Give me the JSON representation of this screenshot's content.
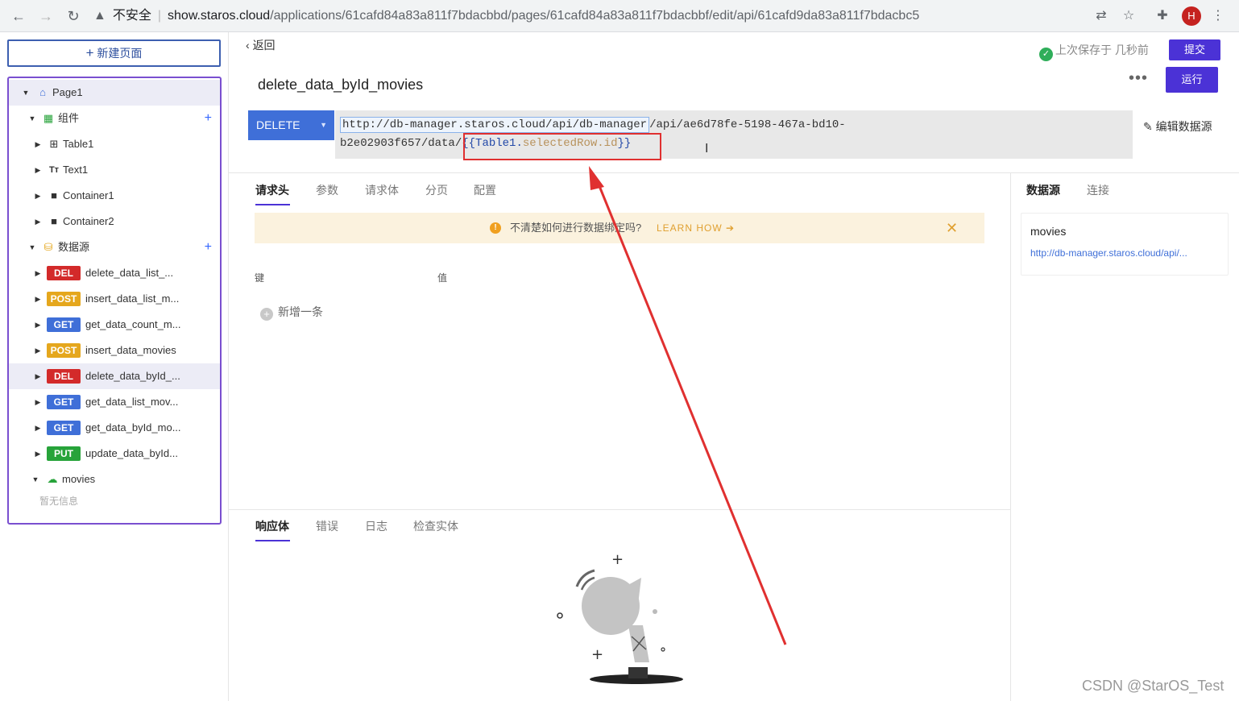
{
  "browser": {
    "insecure_label": "不安全",
    "domain": "show.staros.cloud",
    "path": "/applications/61cafd84a83a811f7bdacbbd/pages/61cafd84a83a811f7bdacbbf/edit/api/61cafd9da83a811f7bdacbc5",
    "avatar_initial": "H"
  },
  "sidebar": {
    "new_page_label": "新建页面",
    "page": "Page1",
    "components_group": "组件",
    "components": [
      "Table1",
      "Text1",
      "Container1",
      "Container2"
    ],
    "datasource_group": "数据源",
    "apis": [
      {
        "method": "DEL",
        "name": "delete_data_list_..."
      },
      {
        "method": "POST",
        "name": "insert_data_list_m..."
      },
      {
        "method": "GET",
        "name": "get_data_count_m..."
      },
      {
        "method": "POST",
        "name": "insert_data_movies"
      },
      {
        "method": "DEL",
        "name": "delete_data_byId_..."
      },
      {
        "method": "GET",
        "name": "get_data_list_mov..."
      },
      {
        "method": "GET",
        "name": "get_data_byId_mo..."
      },
      {
        "method": "PUT",
        "name": "update_data_byId..."
      }
    ],
    "datasource_name": "movies",
    "empty_info": "暂无信息"
  },
  "header": {
    "back_label": "返回",
    "saved_status": "上次保存于 几秒前",
    "submit_label": "提交",
    "run_label": "运行",
    "api_title": "delete_data_byId_movies",
    "edit_datasource": "编辑数据源"
  },
  "request": {
    "method": "DELETE",
    "url_datasource": "http://db-manager.staros.cloud/api/db-manager",
    "url_path_1": "/api/ae6d78fe-5198-467a-bd10-",
    "url_path_2": "b2e02903f657/data/",
    "binding_open": "{{Table1.",
    "binding_prop": "selectedRow.id",
    "binding_close": "}}"
  },
  "request_tabs": [
    "请求头",
    "参数",
    "请求体",
    "分页",
    "配置"
  ],
  "tip": {
    "text": "不清楚如何进行数据绑定吗?",
    "link": "LEARN HOW ➔"
  },
  "headers_table": {
    "key_col": "键",
    "value_col": "值",
    "add_label": "新增一条"
  },
  "right_tabs": [
    "数据源",
    "连接"
  ],
  "datasource_card": {
    "name": "movies",
    "url": "http://db-manager.staros.cloud/api/..."
  },
  "response_tabs": [
    "响应体",
    "错误",
    "日志",
    "检查实体"
  ],
  "watermark": "CSDN @StarOS_Test",
  "colors": {
    "primary": "#4b32d6",
    "method_delete": "#d32a2a",
    "method_post": "#e5a71d",
    "method_get": "#3f6fd8",
    "method_put": "#27a33a",
    "annotation": "#e03030"
  }
}
